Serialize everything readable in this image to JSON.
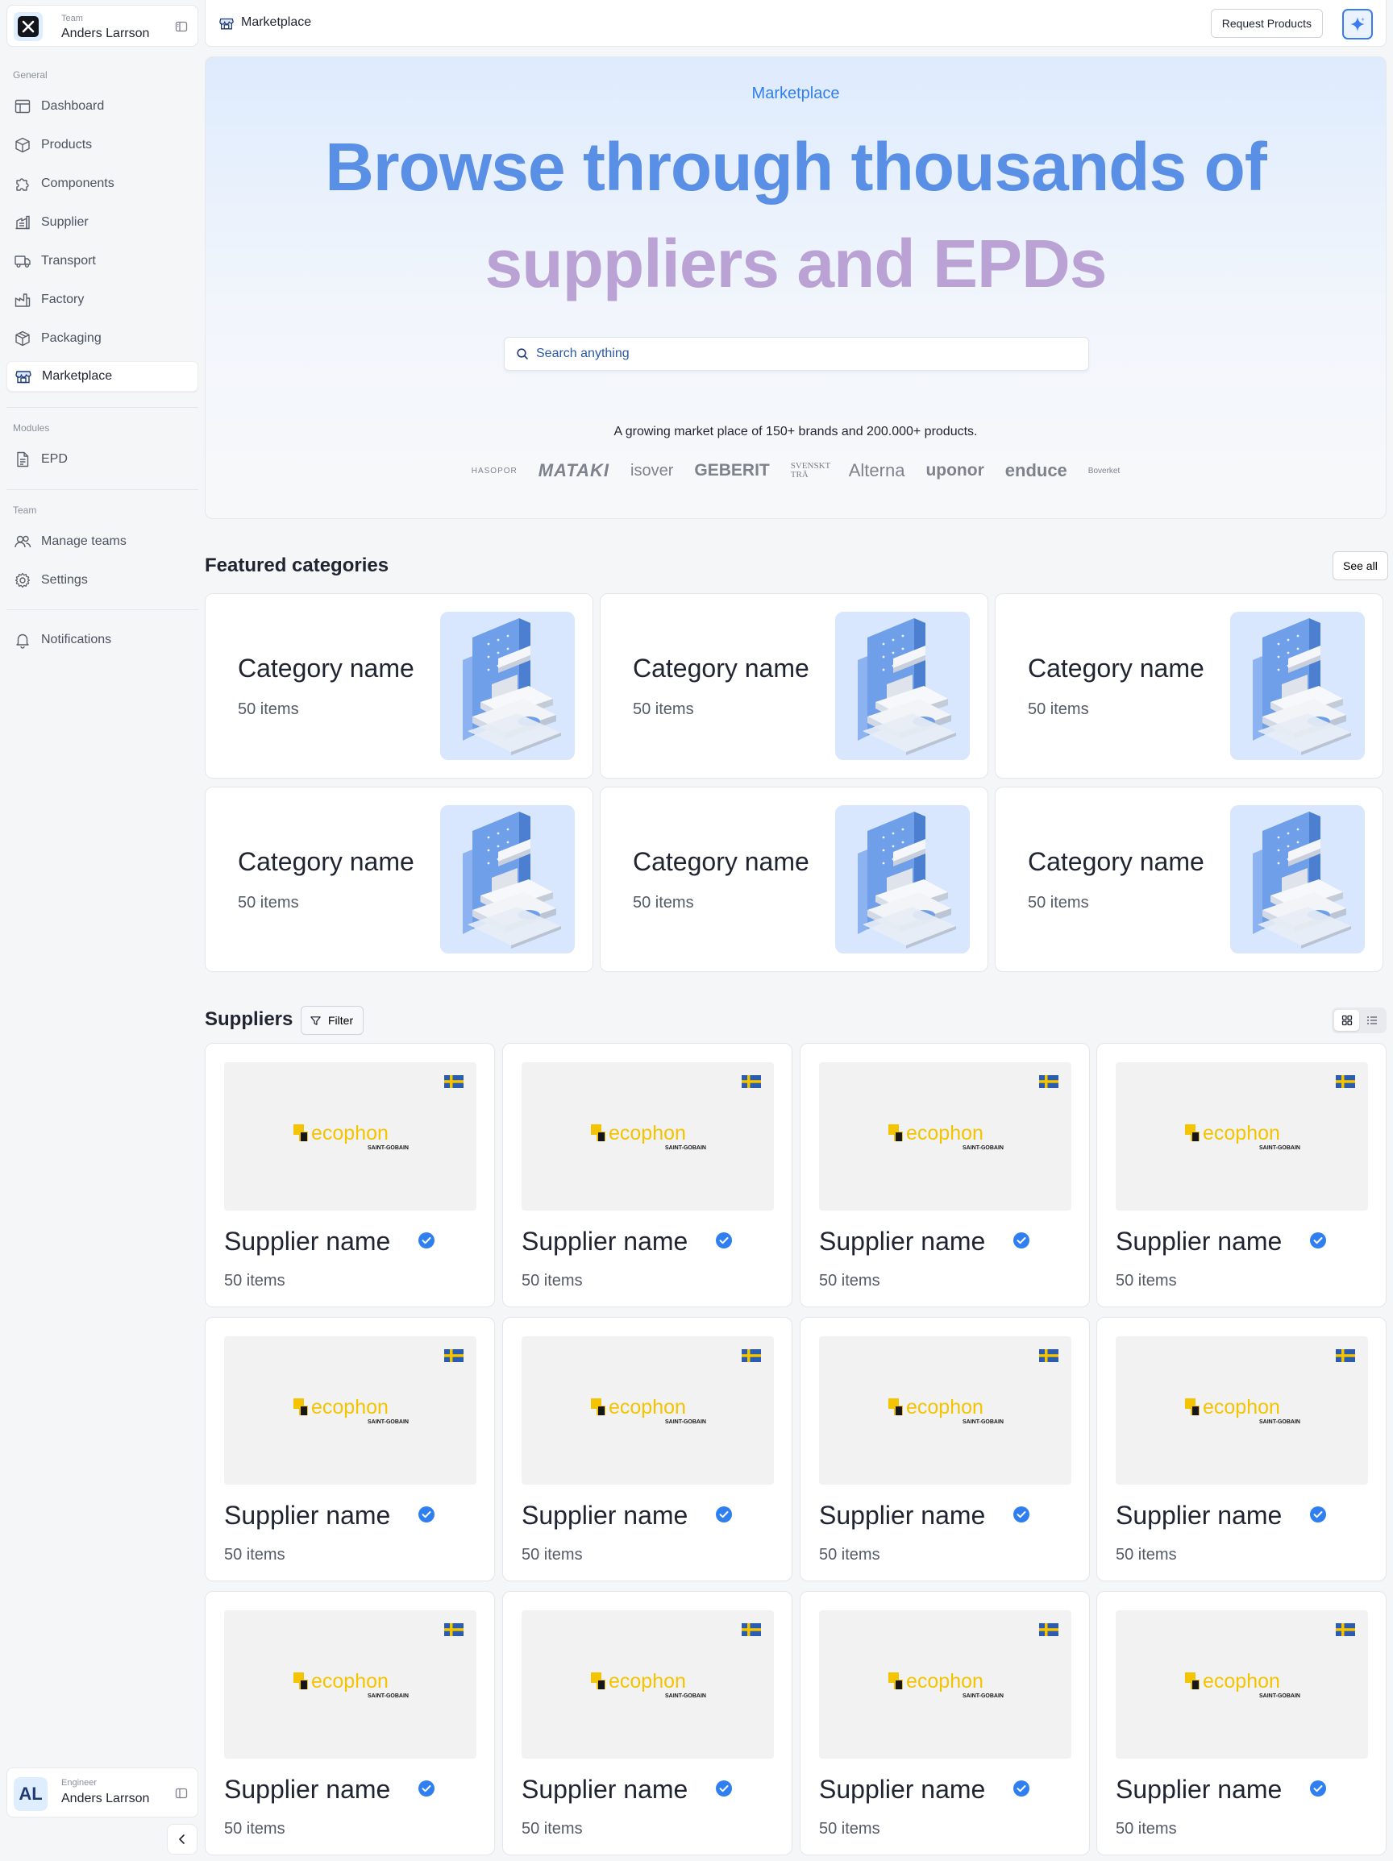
{
  "team": {
    "label": "Team",
    "name": "Anders Larrson"
  },
  "nav": {
    "general_label": "General",
    "general": [
      {
        "label": "Dashboard",
        "icon": "dashboard-icon"
      },
      {
        "label": "Products",
        "icon": "cube-icon"
      },
      {
        "label": "Components",
        "icon": "puzzle-icon"
      },
      {
        "label": "Supplier",
        "icon": "supplier-icon"
      },
      {
        "label": "Transport",
        "icon": "truck-icon"
      },
      {
        "label": "Factory",
        "icon": "factory-icon"
      },
      {
        "label": "Packaging",
        "icon": "package-icon"
      },
      {
        "label": "Marketplace",
        "icon": "store-icon",
        "active": true
      }
    ],
    "modules_label": "Modules",
    "modules": [
      {
        "label": "EPD",
        "icon": "document-icon"
      }
    ],
    "team_label": "Team",
    "team": [
      {
        "label": "Manage teams",
        "icon": "users-icon"
      },
      {
        "label": "Settings",
        "icon": "gear-icon"
      }
    ],
    "notifications": {
      "label": "Notifications",
      "icon": "bell-icon"
    }
  },
  "user": {
    "initials": "AL",
    "role": "Engineer",
    "name": "Anders Larrson"
  },
  "topbar": {
    "crumb": "Marketplace",
    "request_label": "Request Products"
  },
  "hero": {
    "eyebrow": "Marketplace",
    "line1": "Browse through thousands of",
    "line2": "suppliers and EPDs",
    "search_placeholder": "Search anything",
    "tagline": "A growing market place of 150+ brands and 200.000+ products.",
    "brands": [
      "HASOPOR",
      "MATAKI",
      "isover",
      "GEBERIT",
      "SVENSKT TRÄ",
      "Alterna",
      "uponor",
      "enduce",
      "Boverket"
    ]
  },
  "featured": {
    "title": "Featured categories",
    "see_all": "See all",
    "categories": [
      {
        "name": "Category name",
        "count": "50 items"
      },
      {
        "name": "Category name",
        "count": "50 items"
      },
      {
        "name": "Category name",
        "count": "50 items"
      },
      {
        "name": "Category name",
        "count": "50 items"
      },
      {
        "name": "Category name",
        "count": "50 items"
      },
      {
        "name": "Category name",
        "count": "50 items"
      }
    ]
  },
  "suppliers": {
    "title": "Suppliers",
    "filter_label": "Filter",
    "logo_word": "ecophon",
    "logo_sub": "SAINT-GOBAIN",
    "items": [
      {
        "name": "Supplier name",
        "count": "50 items"
      },
      {
        "name": "Supplier name",
        "count": "50 items"
      },
      {
        "name": "Supplier name",
        "count": "50 items"
      },
      {
        "name": "Supplier name",
        "count": "50 items"
      },
      {
        "name": "Supplier name",
        "count": "50 items"
      },
      {
        "name": "Supplier name",
        "count": "50 items"
      },
      {
        "name": "Supplier name",
        "count": "50 items"
      },
      {
        "name": "Supplier name",
        "count": "50 items"
      },
      {
        "name": "Supplier name",
        "count": "50 items"
      },
      {
        "name": "Supplier name",
        "count": "50 items"
      },
      {
        "name": "Supplier name",
        "count": "50 items"
      },
      {
        "name": "Supplier name",
        "count": "50 items"
      }
    ]
  },
  "colors": {
    "accent": "#2f7ff0",
    "hero_line1": "#5a8fe6",
    "hero_line2": "#bba2d5",
    "verified": "#2f7ff0",
    "ecophon_yellow": "#f5c400"
  }
}
